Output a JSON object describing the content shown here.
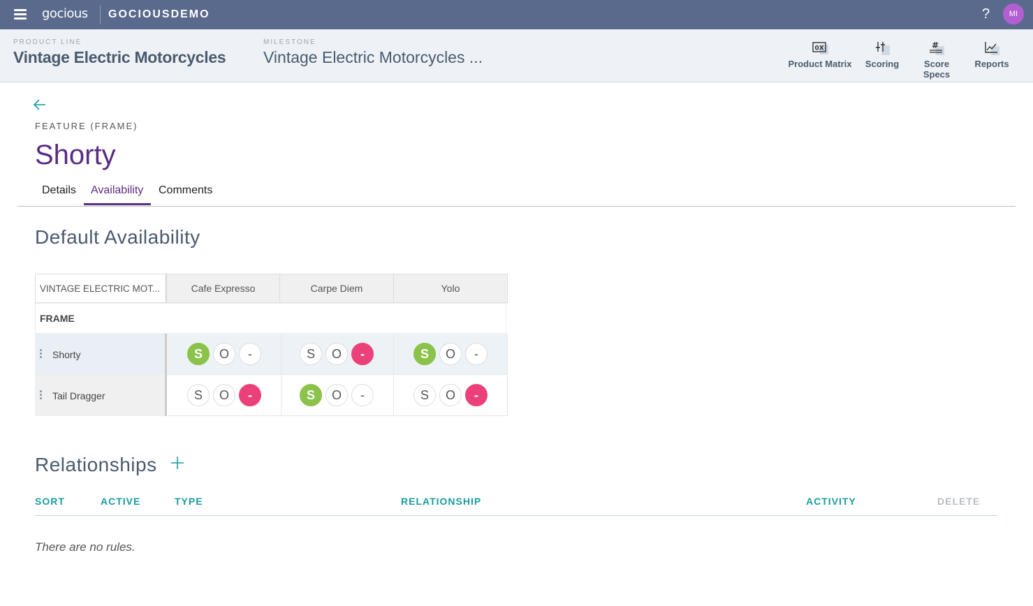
{
  "topbar": {
    "logo": "gocious",
    "tenant": "GOCIOUSDEMO",
    "help": "?",
    "avatar_initials": "MI"
  },
  "header": {
    "product_line_label": "PRODUCT LINE",
    "product_line": "Vintage Electric Motorcycles",
    "milestone_label": "MILESTONE",
    "milestone": "Vintage Electric Motorcycles ...",
    "tools": [
      {
        "label": "Product Matrix",
        "icon": "product-matrix-icon"
      },
      {
        "label": "Scoring",
        "icon": "scoring-icon"
      },
      {
        "label": "Score Specs",
        "icon": "score-specs-icon"
      },
      {
        "label": "Reports",
        "icon": "reports-icon"
      }
    ]
  },
  "feature": {
    "type_label": "FEATURE (FRAME)",
    "title": "Shorty"
  },
  "tabs": [
    {
      "label": "Details",
      "active": false
    },
    {
      "label": "Availability",
      "active": true
    },
    {
      "label": "Comments",
      "active": false
    }
  ],
  "availability": {
    "title": "Default Availability",
    "corner_header": "VINTAGE ELECTRIC MOT...",
    "columns": [
      "Cafe Expresso",
      "Carpe Diem",
      "Yolo"
    ],
    "group": "FRAME",
    "option_labels": [
      "S",
      "O",
      "-"
    ],
    "rows": [
      {
        "name": "Shorty",
        "selected": [
          "S",
          "-",
          "S"
        ]
      },
      {
        "name": "Tail Dragger",
        "selected": [
          "-",
          "S",
          "-"
        ]
      }
    ]
  },
  "relationships": {
    "title": "Relationships",
    "columns": [
      "SORT",
      "ACTIVE",
      "TYPE",
      "RELATIONSHIP",
      "ACTIVITY",
      "DELETE"
    ],
    "empty_message": "There are no rules."
  },
  "colors": {
    "topbar": "#5a6a8c",
    "accent_purple": "#5b2c83",
    "standard_green": "#8bc34a",
    "not_available_pink": "#ec407a",
    "teal_header": "#1a9ca0"
  }
}
